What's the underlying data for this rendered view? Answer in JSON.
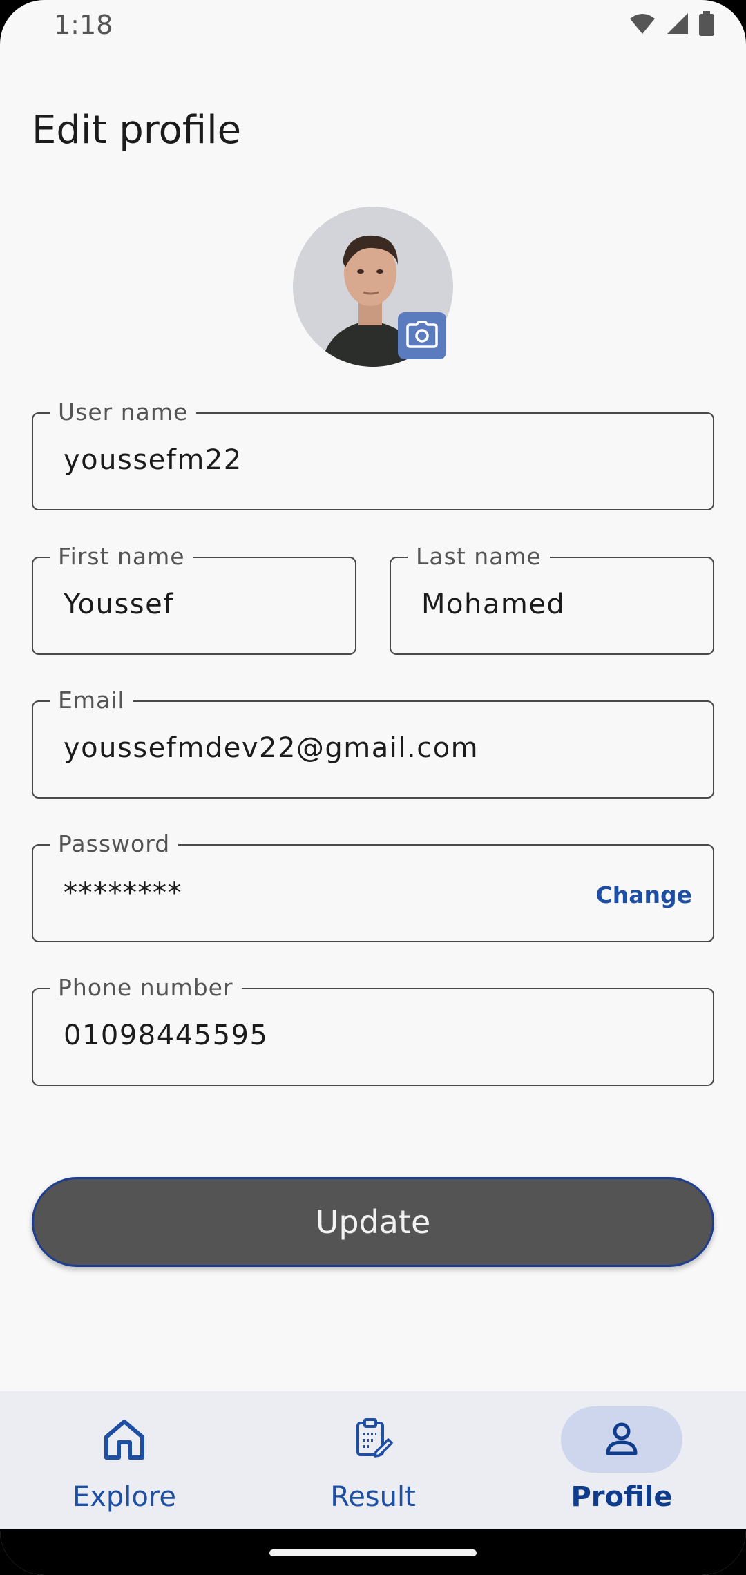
{
  "status_bar": {
    "time": "1:18",
    "icons": [
      "wifi-icon",
      "signal-icon",
      "battery-icon"
    ]
  },
  "page": {
    "title": "Edit profile"
  },
  "avatar": {
    "camera_icon": "camera-icon"
  },
  "form": {
    "username": {
      "label": "User name",
      "value": "youssefm22"
    },
    "first_name": {
      "label": "First name",
      "value": "Youssef"
    },
    "last_name": {
      "label": "Last name",
      "value": "Mohamed"
    },
    "email": {
      "label": "Email",
      "value": "youssefmdev22@gmail.com"
    },
    "password": {
      "label": "Password",
      "value": "********",
      "change_label": "Change"
    },
    "phone": {
      "label": "Phone number",
      "value": "01098445595"
    }
  },
  "actions": {
    "update_label": "Update"
  },
  "bottom_nav": {
    "items": [
      {
        "label": "Explore",
        "icon": "home-icon",
        "active": false
      },
      {
        "label": "Result",
        "icon": "clipboard-edit-icon",
        "active": false
      },
      {
        "label": "Profile",
        "icon": "person-icon",
        "active": true
      }
    ]
  },
  "colors": {
    "accent": "#1e4fa3",
    "active_pill": "#cdd6ec",
    "button": "#545454",
    "camera_badge": "#5a7bbd"
  }
}
